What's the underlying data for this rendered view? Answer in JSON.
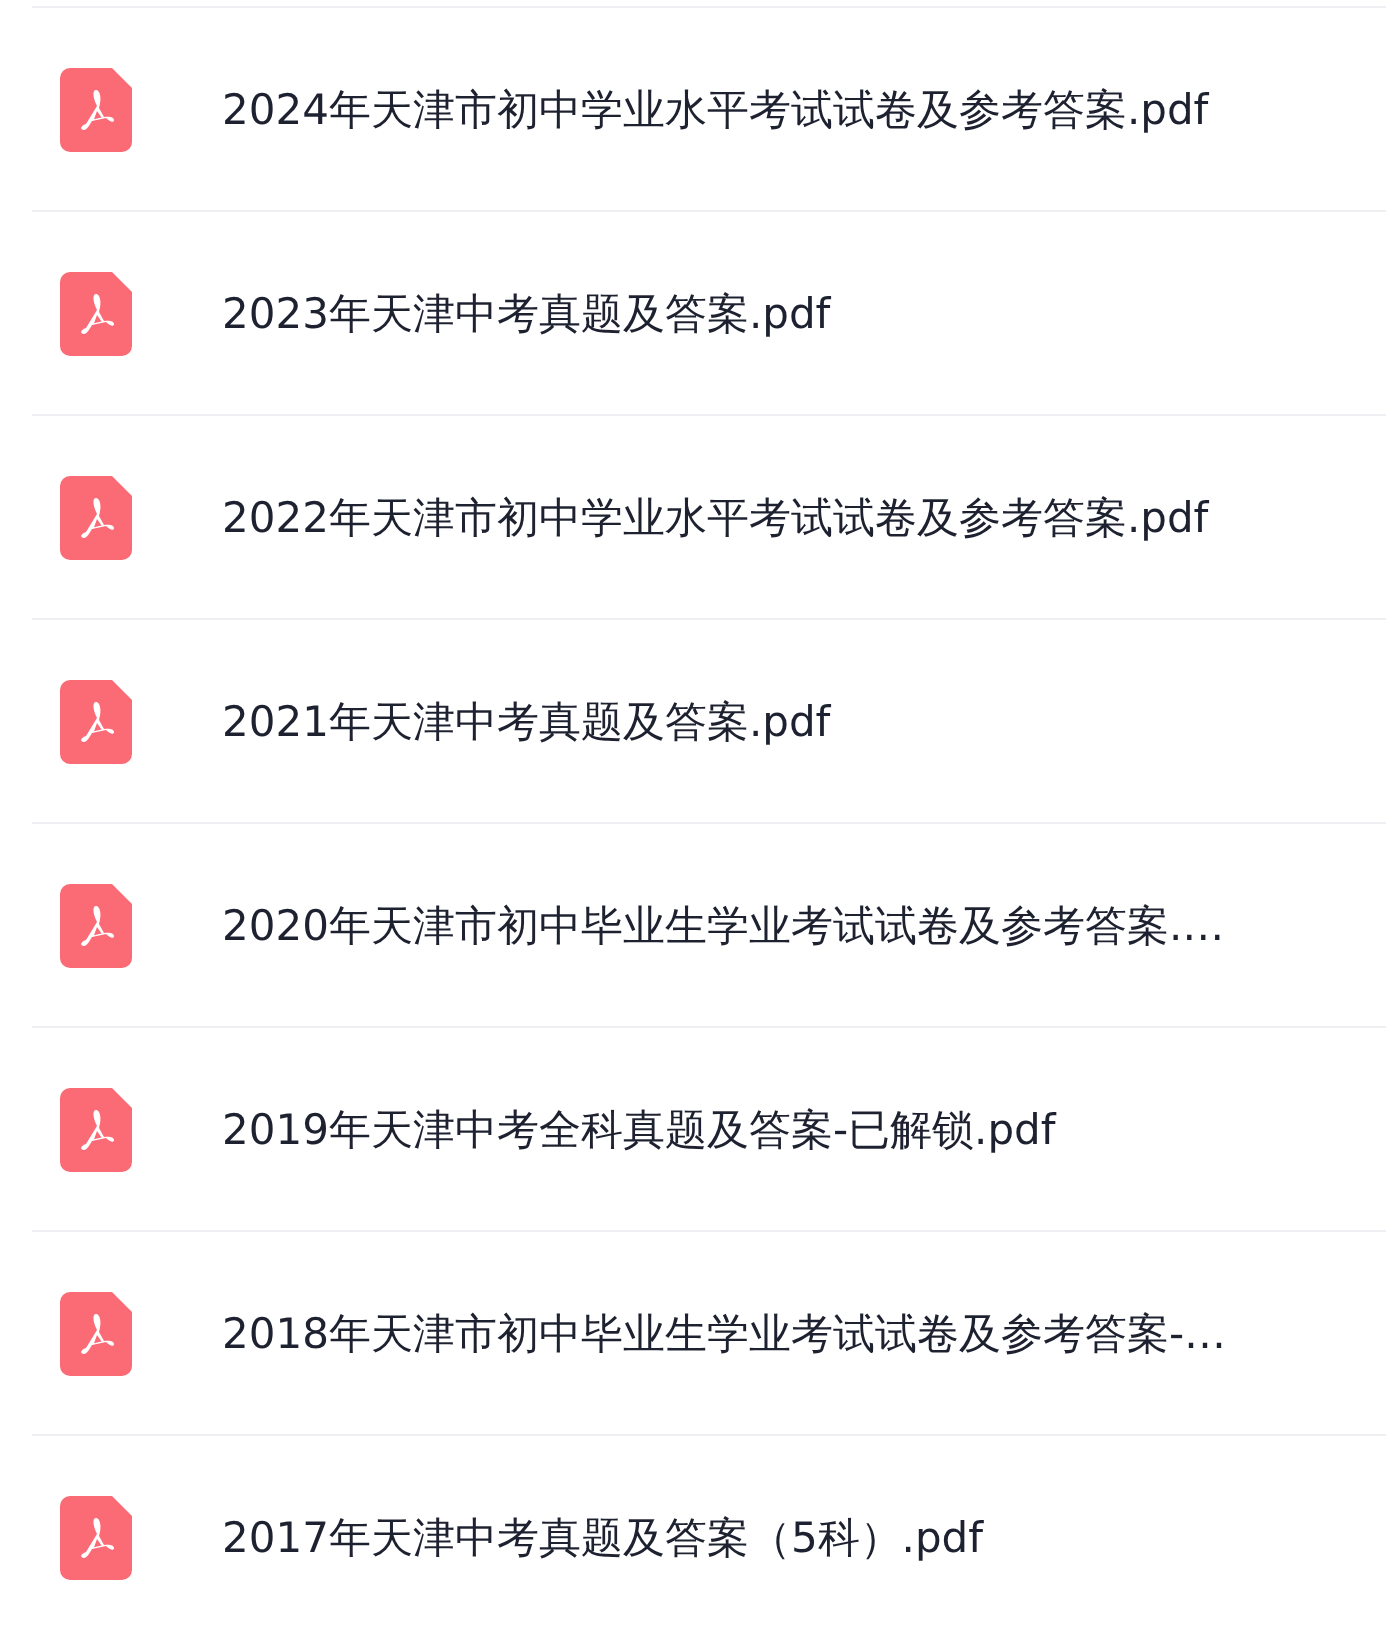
{
  "files": [
    {
      "name": "2024年天津市初中学业水平考试试卷及参考答案.pdf"
    },
    {
      "name": "2023年天津中考真题及答案.pdf"
    },
    {
      "name": "2022年天津市初中学业水平考试试卷及参考答案.pdf"
    },
    {
      "name": "2021年天津中考真题及答案.pdf"
    },
    {
      "name": "2020年天津市初中毕业生学业考试试卷及参考答案.…"
    },
    {
      "name": "2019年天津中考全科真题及答案-已解锁.pdf"
    },
    {
      "name": "2018年天津市初中毕业生学业考试试卷及参考答案-…"
    },
    {
      "name": "2017年天津中考真题及答案（5科）.pdf"
    }
  ]
}
